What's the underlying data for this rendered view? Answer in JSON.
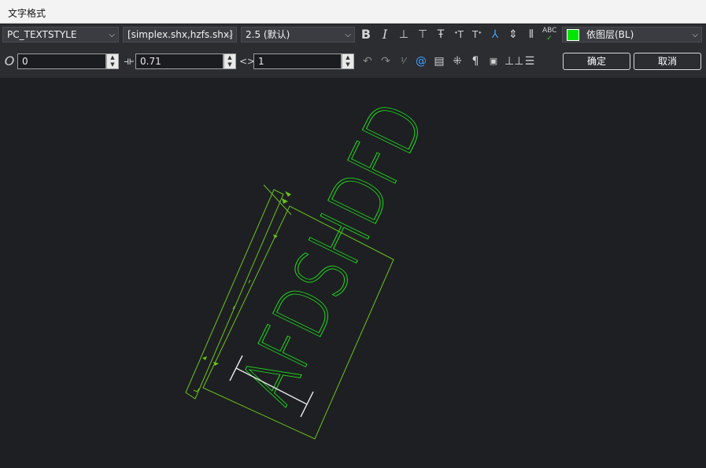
{
  "window": {
    "title": "文字格式"
  },
  "toolbar": {
    "style": {
      "value": "PC_TEXTSTYLE"
    },
    "font": {
      "value": "[simplex.shx,hzfs.shx]"
    },
    "height": {
      "value": "2.5 (默认)"
    },
    "layer": {
      "value": "依图层(BL)",
      "color": "#00e600"
    },
    "oblique": {
      "value": "0"
    },
    "width_factor": {
      "value": "0.71"
    },
    "tracking": {
      "value": "1"
    },
    "ok_label": "确定",
    "cancel_label": "取消"
  },
  "canvas": {
    "text": "AFDSHDFD",
    "text_color": "#1ecf1e",
    "frame_color": "#6bc41a",
    "cursor_color": "#e8e8e8"
  }
}
